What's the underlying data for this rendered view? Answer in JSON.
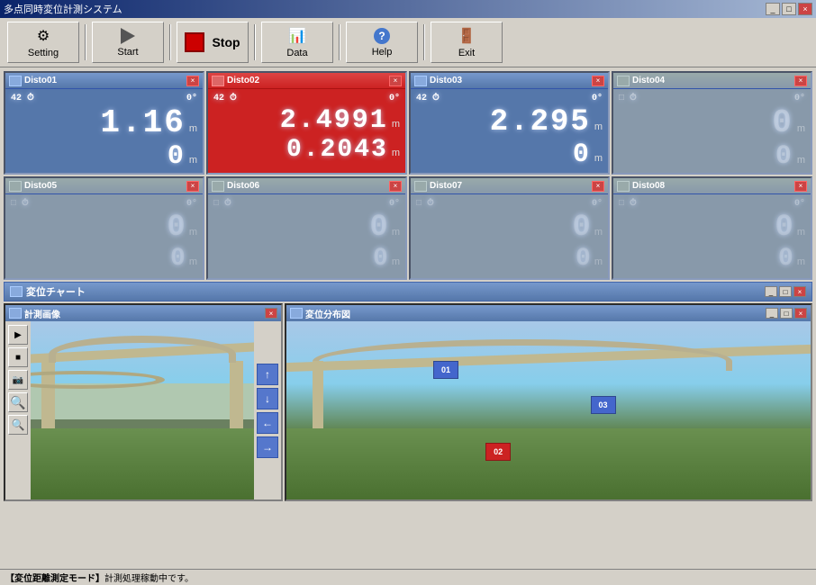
{
  "window": {
    "title": "多点同時変位計測システム",
    "titlebar_buttons": [
      "_",
      "□",
      "×"
    ]
  },
  "toolbar": {
    "setting_label": "Setting",
    "start_label": "Start",
    "stop_label": "Stop",
    "data_label": "Data",
    "help_label": "Help",
    "exit_label": "Exit"
  },
  "disto_panels": [
    {
      "id": "disto01",
      "title": "Disto01",
      "active": true,
      "red_bg": false,
      "counter": "42",
      "angle": "0°",
      "value1": "1.16",
      "value2": "0",
      "unit": "m"
    },
    {
      "id": "disto02",
      "title": "Disto02",
      "active": true,
      "red_bg": true,
      "counter": "42",
      "angle": "0°",
      "value1": "2.4991",
      "value2": "0.2043",
      "unit": "m"
    },
    {
      "id": "disto03",
      "title": "Disto03",
      "active": true,
      "red_bg": false,
      "counter": "42",
      "angle": "0°",
      "value1": "2.295",
      "value2": "0",
      "unit": "m"
    },
    {
      "id": "disto04",
      "title": "Disto04",
      "active": false,
      "red_bg": false,
      "counter": "",
      "angle": "",
      "value1": "0",
      "value2": "0",
      "unit": "m"
    },
    {
      "id": "disto05",
      "title": "Disto05",
      "active": false,
      "red_bg": false,
      "counter": "",
      "angle": "",
      "value1": "0",
      "value2": "0",
      "unit": "m"
    },
    {
      "id": "disto06",
      "title": "Disto06",
      "active": false,
      "red_bg": false,
      "counter": "",
      "angle": "",
      "value1": "0",
      "value2": "0",
      "unit": "m"
    },
    {
      "id": "disto07",
      "title": "Disto07",
      "active": false,
      "red_bg": false,
      "counter": "",
      "angle": "",
      "value1": "0",
      "value2": "0",
      "unit": "m"
    },
    {
      "id": "disto08",
      "title": "Disto08",
      "active": false,
      "red_bg": false,
      "counter": "",
      "angle": "",
      "value1": "0",
      "value2": "0",
      "unit": "m"
    }
  ],
  "chart": {
    "title": "変位チャート"
  },
  "camera": {
    "title": "計測画像"
  },
  "distribution": {
    "title": "変位分布図",
    "markers": [
      {
        "id": "01",
        "color": "blue",
        "left": "28%",
        "top": "25%"
      },
      {
        "id": "03",
        "color": "blue",
        "left": "62%",
        "top": "45%"
      },
      {
        "id": "02",
        "color": "red",
        "left": "42%",
        "top": "72%"
      }
    ]
  },
  "status": {
    "bracket_text": "【変位距離測定モード】",
    "message": "計測処理稼動中です。"
  },
  "direction_buttons": [
    "↑",
    "↓",
    "←",
    "→"
  ]
}
